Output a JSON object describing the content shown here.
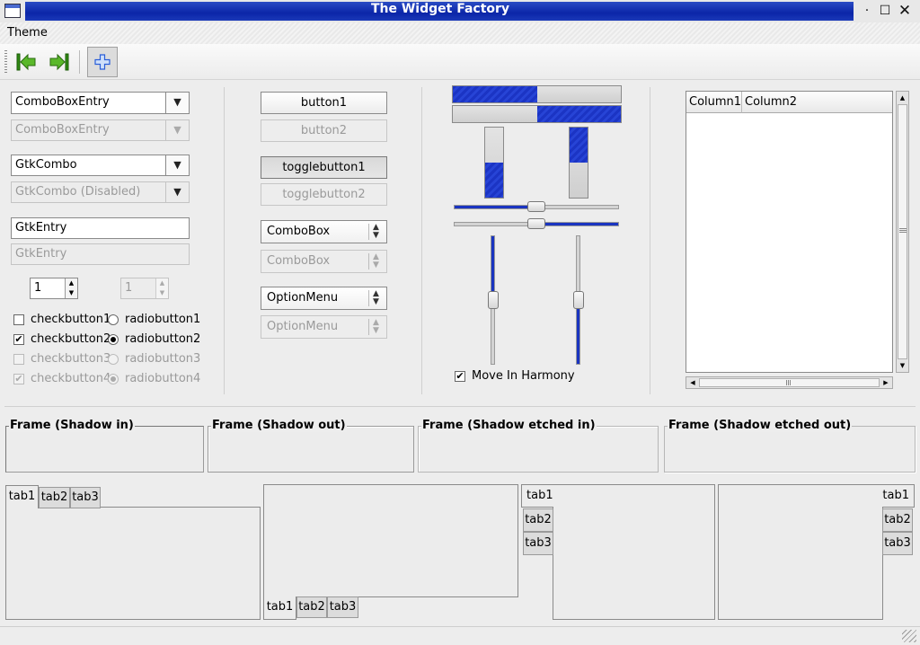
{
  "window": {
    "title": "The Widget Factory"
  },
  "menubar": {
    "theme": "Theme"
  },
  "toolbar": {
    "back_icon": "go-first-icon",
    "forward_icon": "go-last-icon",
    "add_icon": "add-icon"
  },
  "entries": {
    "comboboxentry": "ComboBoxEntry",
    "comboboxentry_disabled": "ComboBoxEntry",
    "gtkcombo": "GtkCombo",
    "gtkcombo_disabled": "GtkCombo (Disabled)",
    "gtkentry": "GtkEntry",
    "gtkentry_disabled": "GtkEntry",
    "spin1": "1",
    "spin2": "1"
  },
  "checks": [
    {
      "label": "checkbutton1",
      "checked": false,
      "disabled": false
    },
    {
      "label": "checkbutton2",
      "checked": true,
      "disabled": false
    },
    {
      "label": "checkbutton3",
      "checked": false,
      "disabled": true
    },
    {
      "label": "checkbutton4",
      "checked": true,
      "disabled": true
    }
  ],
  "radios": [
    {
      "label": "radiobutton1",
      "checked": false,
      "disabled": false
    },
    {
      "label": "radiobutton2",
      "checked": true,
      "disabled": false
    },
    {
      "label": "radiobutton3",
      "checked": false,
      "disabled": true
    },
    {
      "label": "radiobutton4",
      "checked": true,
      "disabled": true
    }
  ],
  "buttons": {
    "button1": "button1",
    "button2": "button2",
    "toggle1": "togglebutton1",
    "toggle2": "togglebutton2",
    "combobox": "ComboBox",
    "combobox_disabled": "ComboBox",
    "optionmenu": "OptionMenu",
    "optionmenu_disabled": "OptionMenu"
  },
  "progress": {
    "h1": 0.5,
    "h2": 0.5,
    "v1": 0.5,
    "v2": 0.5
  },
  "scales": {
    "h1": 0.5,
    "h2": 0.5,
    "v1": 0.5,
    "v2": 0.5,
    "harmony_label": "Move In Harmony",
    "harmony_checked": true
  },
  "tree": {
    "columns": [
      "Column1",
      "Column2"
    ]
  },
  "frames": [
    {
      "label": "Frame (Shadow in)"
    },
    {
      "label": "Frame (Shadow out)"
    },
    {
      "label": "Frame (Shadow etched in)"
    },
    {
      "label": "Frame (Shadow etched out)"
    }
  ],
  "notebooks": {
    "tabs": [
      "tab1",
      "tab2",
      "tab3"
    ]
  },
  "colors": {
    "accent": "#1a34c0",
    "title_bar": "#0b26a8"
  }
}
